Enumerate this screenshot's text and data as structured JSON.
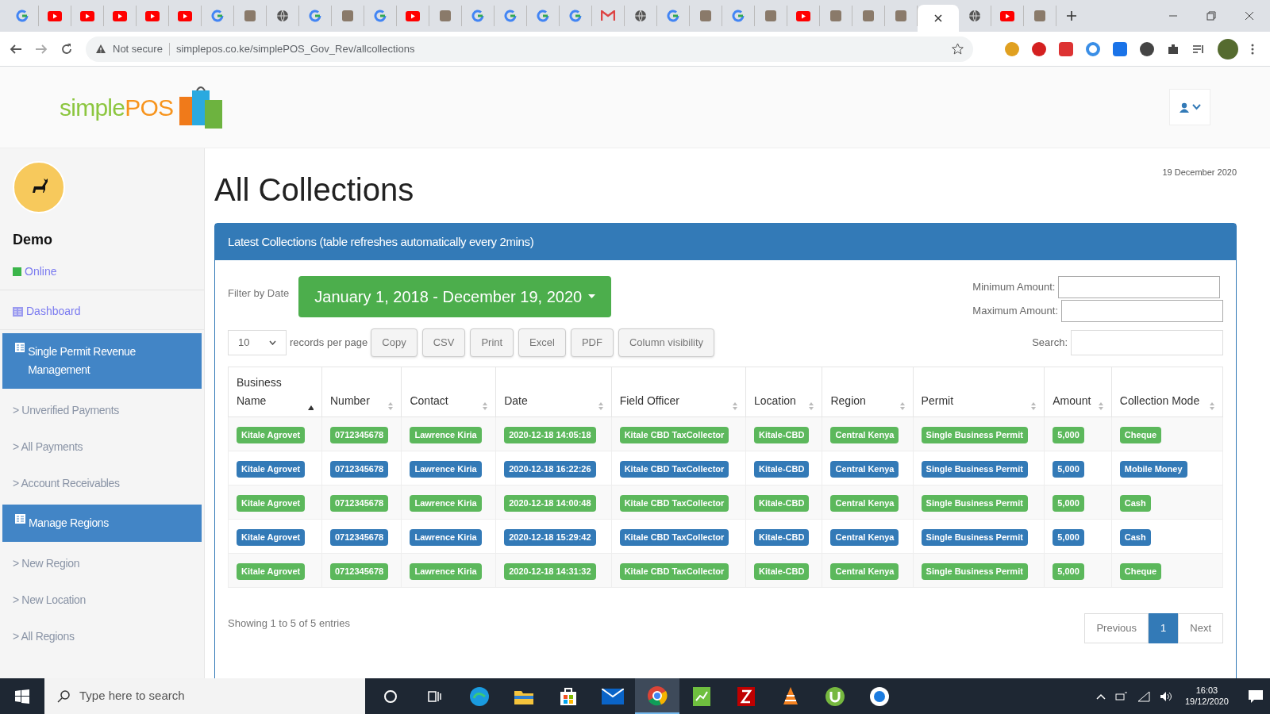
{
  "browser": {
    "tabs": [
      {
        "kind": "google",
        "selected": false
      },
      {
        "kind": "video",
        "selected": false
      },
      {
        "kind": "video",
        "selected": false
      },
      {
        "kind": "video",
        "selected": false
      },
      {
        "kind": "video",
        "selected": false
      },
      {
        "kind": "video",
        "selected": false
      },
      {
        "kind": "google",
        "selected": false
      },
      {
        "kind": "generic",
        "selected": false
      },
      {
        "kind": "globe",
        "selected": false
      },
      {
        "kind": "google",
        "selected": false
      },
      {
        "kind": "generic",
        "selected": false
      },
      {
        "kind": "google",
        "selected": false
      },
      {
        "kind": "video",
        "selected": false
      },
      {
        "kind": "generic",
        "selected": false
      },
      {
        "kind": "google",
        "selected": false
      },
      {
        "kind": "google",
        "selected": false
      },
      {
        "kind": "google",
        "selected": false
      },
      {
        "kind": "google",
        "selected": false
      },
      {
        "kind": "mail",
        "selected": false
      },
      {
        "kind": "globe",
        "selected": false
      },
      {
        "kind": "google",
        "selected": false
      },
      {
        "kind": "generic",
        "selected": false
      },
      {
        "kind": "google",
        "selected": false
      },
      {
        "kind": "generic",
        "selected": false
      },
      {
        "kind": "video",
        "selected": false
      },
      {
        "kind": "generic",
        "selected": false
      },
      {
        "kind": "generic",
        "selected": false
      },
      {
        "kind": "generic",
        "selected": false
      },
      {
        "kind": "blank",
        "selected": true
      },
      {
        "kind": "globe",
        "selected": false
      },
      {
        "kind": "video",
        "selected": false
      },
      {
        "kind": "generic",
        "selected": false
      }
    ],
    "security": "Not secure",
    "url": "simplepos.co.ke/simplePOS_Gov_Rev/allcollections"
  },
  "header": {
    "logo": {
      "first": "simple",
      "second": "POS"
    }
  },
  "sidebar": {
    "user": "Demo",
    "status": "Online",
    "items": [
      {
        "kind": "link",
        "label": "Dashboard"
      },
      {
        "kind": "section",
        "label": "Single Permit Revenue Management"
      },
      {
        "kind": "subitem",
        "label": "> Unverified Payments"
      },
      {
        "kind": "subitem",
        "label": "> All Payments"
      },
      {
        "kind": "subitem",
        "label": "> Account Receivables"
      },
      {
        "kind": "section",
        "label": "Manage Regions"
      },
      {
        "kind": "subitem",
        "label": "> New Region"
      },
      {
        "kind": "subitem",
        "label": "> New Location"
      },
      {
        "kind": "subitem",
        "label": "> All Regions"
      }
    ]
  },
  "page": {
    "title": "All Collections",
    "date": "19 December 2020"
  },
  "panel": {
    "title": "Latest Collections (table refreshes automatically every 2mins)",
    "filter_label": "Filter by Date",
    "date_range": "January 1, 2018 - December 19, 2020",
    "min_label": "Minimum Amount:",
    "max_label": "Maximum Amount:",
    "page_size": "10",
    "page_size_label": "records per page",
    "buttons": [
      "Copy",
      "CSV",
      "Print",
      "Excel",
      "PDF",
      "Column visibility"
    ],
    "search_label": "Search:",
    "columns": [
      {
        "label": "Business Name",
        "sorted": true
      },
      {
        "label": "Number",
        "sorted": false
      },
      {
        "label": "Contact",
        "sorted": false
      },
      {
        "label": "Date",
        "sorted": false
      },
      {
        "label": "Field Officer",
        "sorted": false
      },
      {
        "label": "Location",
        "sorted": false
      },
      {
        "label": "Region",
        "sorted": false
      },
      {
        "label": "Permit",
        "sorted": false
      },
      {
        "label": "Amount",
        "sorted": false
      },
      {
        "label": "Collection Mode",
        "sorted": false
      }
    ],
    "rows": [
      {
        "color": "#5cb85c",
        "cells": [
          "Kitale Agrovet",
          "0712345678",
          "Lawrence Kiria",
          "2020-12-18 14:05:18",
          "Kitale CBD TaxCollector",
          "Kitale-CBD",
          "Central Kenya",
          "Single Business Permit",
          "5,000",
          "Cheque"
        ]
      },
      {
        "color": "#337ab7",
        "cells": [
          "Kitale Agrovet",
          "0712345678",
          "Lawrence Kiria",
          "2020-12-18 16:22:26",
          "Kitale CBD TaxCollector",
          "Kitale-CBD",
          "Central Kenya",
          "Single Business Permit",
          "5,000",
          "Mobile Money"
        ]
      },
      {
        "color": "#5cb85c",
        "cells": [
          "Kitale Agrovet",
          "0712345678",
          "Lawrence Kiria",
          "2020-12-18 14:00:48",
          "Kitale CBD TaxCollector",
          "Kitale-CBD",
          "Central Kenya",
          "Single Business Permit",
          "5,000",
          "Cash"
        ]
      },
      {
        "color": "#337ab7",
        "cells": [
          "Kitale Agrovet",
          "0712345678",
          "Lawrence Kiria",
          "2020-12-18 15:29:42",
          "Kitale CBD TaxCollector",
          "Kitale-CBD",
          "Central Kenya",
          "Single Business Permit",
          "5,000",
          "Cash"
        ]
      },
      {
        "color": "#5cb85c",
        "cells": [
          "Kitale Agrovet",
          "0712345678",
          "Lawrence Kiria",
          "2020-12-18 14:31:32",
          "Kitale CBD TaxCollector",
          "Kitale-CBD",
          "Central Kenya",
          "Single Business Permit",
          "5,000",
          "Cheque"
        ]
      }
    ],
    "info": "Showing 1 to 5 of 5 entries",
    "pagination": [
      {
        "label": "Previous",
        "selected": false
      },
      {
        "label": "1",
        "selected": true
      },
      {
        "label": "Next",
        "selected": false
      }
    ]
  },
  "taskbar": {
    "search_placeholder": "Type here to search",
    "apps": [
      {
        "kind": "cortana",
        "selected": false
      },
      {
        "kind": "taskview",
        "selected": false
      },
      {
        "kind": "edge",
        "selected": false
      },
      {
        "kind": "folder",
        "selected": false
      },
      {
        "kind": "store",
        "selected": false
      },
      {
        "kind": "mail",
        "selected": false
      },
      {
        "kind": "chrome",
        "selected": true
      },
      {
        "kind": "sheet",
        "selected": false
      },
      {
        "kind": "ftp",
        "selected": false
      },
      {
        "kind": "cone",
        "selected": false
      },
      {
        "kind": "torrent",
        "selected": false
      },
      {
        "kind": "circle",
        "selected": false
      }
    ],
    "time": "16:03",
    "date": "19/12/2020"
  }
}
